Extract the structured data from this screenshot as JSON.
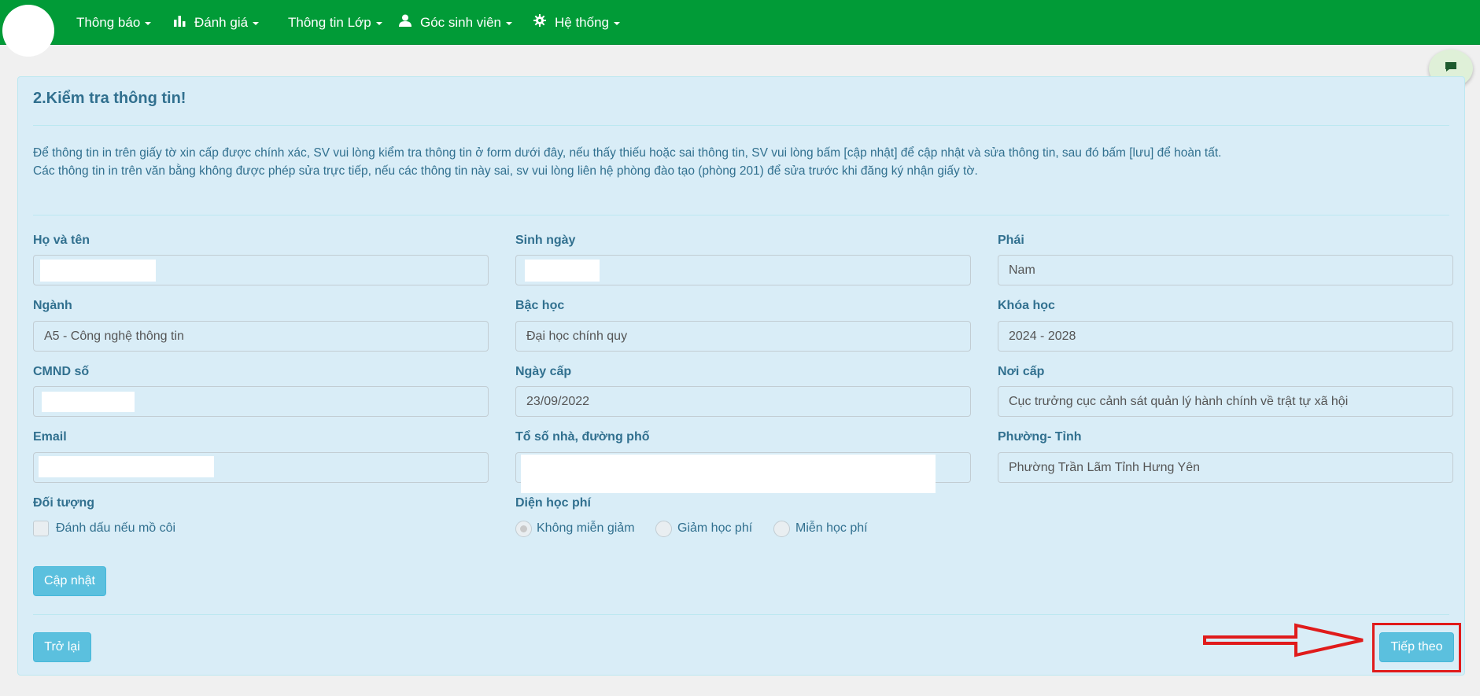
{
  "navbar": {
    "items": [
      {
        "label": "Thông báo",
        "icon": "none",
        "has_caret": true
      },
      {
        "label": "Đánh giá",
        "icon": "bar-chart-icon",
        "has_caret": true
      },
      {
        "label": "Thông tin Lớp",
        "icon": "none",
        "has_caret": true
      },
      {
        "label": "Góc sinh viên",
        "icon": "user-icon",
        "has_caret": true
      },
      {
        "label": "Hệ thống",
        "icon": "gear-icon",
        "has_caret": true
      }
    ],
    "background_color": "#019b37"
  },
  "chat": {
    "icon": "chat-icon"
  },
  "panel": {
    "title": "2.Kiểm tra thông tin!",
    "info_line1": "Để thông tin in trên giấy tờ xin cấp được chính xác, SV vui lòng kiểm tra thông tin ở form dưới đây, nếu thấy thiếu hoặc sai thông tin, SV vui lòng bấm [cập nhật] để cập nhật và sửa thông tin, sau đó bấm [lưu] để hoàn tất.",
    "info_line2": "Các thông tin in trên văn bằng không được phép sửa trực tiếp, nếu các thông tin này sai, sv vui lòng liên hệ phòng đào tạo (phòng 201) để sửa trước khi đăng ký nhận giấy tờ.",
    "background_color": "#d9edf7",
    "text_color": "#31708f"
  },
  "form": {
    "ho_ten": {
      "label": "Họ và tên",
      "value": ""
    },
    "sinh_ngay": {
      "label": "Sinh ngày",
      "value": ""
    },
    "phai": {
      "label": "Phái",
      "value": "Nam"
    },
    "nganh": {
      "label": "Ngành",
      "value": "A5 - Công nghệ thông tin"
    },
    "bac_hoc": {
      "label": "Bậc học",
      "value": "Đại học chính quy"
    },
    "khoa_hoc": {
      "label": "Khóa học",
      "value": "2024 - 2028"
    },
    "cmnd": {
      "label": "CMND số",
      "value": ""
    },
    "ngay_cap": {
      "label": "Ngày cấp",
      "value": "23/09/2022"
    },
    "noi_cap": {
      "label": "Nơi cấp",
      "value": "Cục trưởng cục cảnh sát quản lý hành chính về trật tự xã hội"
    },
    "email": {
      "label": "Email",
      "value": ""
    },
    "dia_chi": {
      "label": "Tổ số nhà, đường phố",
      "value": ""
    },
    "phuong_tinh": {
      "label": "Phường- Tỉnh",
      "value": "Phường Trần Lãm Tỉnh Hưng Yên"
    },
    "doi_tuong": {
      "label": "Đối tượng",
      "checkbox_label": "Đánh dấu nếu mồ côi",
      "checked": false
    },
    "dien_hoc_phi": {
      "label": "Diện học phí",
      "options": [
        "Không miễn giảm",
        "Giảm học phí",
        "Miễn học phí"
      ],
      "selected": "Không miễn giảm"
    }
  },
  "buttons": {
    "cap_nhat": "Cập nhật",
    "tro_lai": "Trở lại",
    "tiep_theo": "Tiếp theo",
    "color": "#5bc0de"
  },
  "annotation": {
    "color": "#e01b1b"
  }
}
